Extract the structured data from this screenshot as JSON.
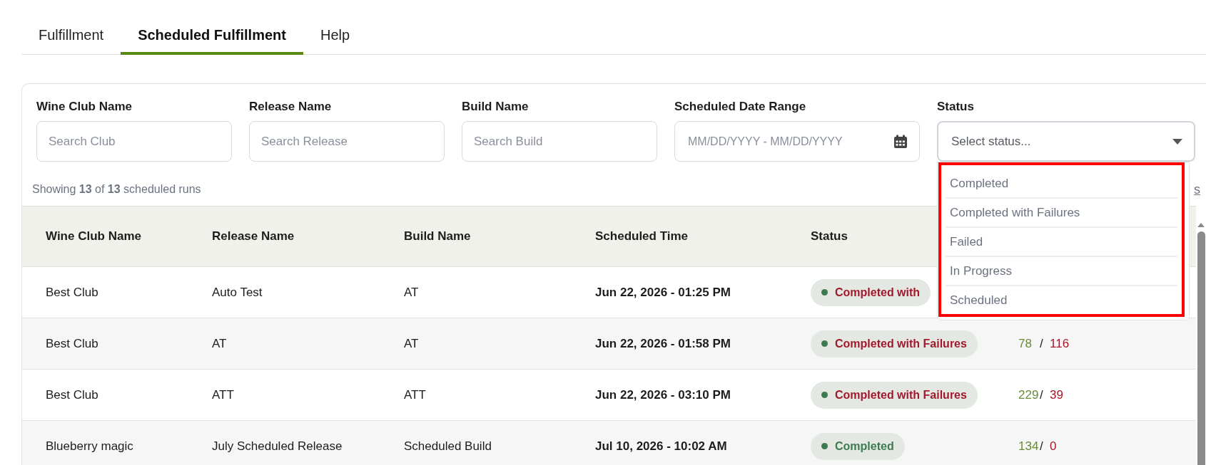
{
  "tabs": [
    {
      "label": "Fulfillment",
      "selected": false
    },
    {
      "label": "Scheduled Fulfillment",
      "selected": true
    },
    {
      "label": "Help",
      "selected": false
    }
  ],
  "filters": [
    {
      "kind": "text",
      "label": "Wine Club Name",
      "placeholder": "Search Club"
    },
    {
      "kind": "text",
      "label": "Release Name",
      "placeholder": "Search Release"
    },
    {
      "kind": "text",
      "label": "Build Name",
      "placeholder": "Search Build"
    },
    {
      "kind": "date",
      "label": "Scheduled Date Range",
      "placeholder": "MM/DD/YYYY - MM/DD/YYYY"
    },
    {
      "kind": "select",
      "label": "Status",
      "placeholder": "Select status...",
      "expanded": true,
      "options": [
        "Completed",
        "Completed with Failures",
        "Failed",
        "In Progress",
        "Scheduled"
      ]
    }
  ],
  "summary": "Showing **13** of **13** scheduled runs",
  "summary_link": "s",
  "table": {
    "columns": [
      "Wine Club Name",
      "Release Name",
      "Build Name",
      "Scheduled Time",
      "Status"
    ],
    "rows": [
      {
        "club": "Best Club",
        "release": "Auto Test",
        "build": "AT",
        "time": "Jun 22, 2026 - 01:25 PM",
        "status": {
          "label": "Completed with",
          "kind": "failures"
        }
      },
      {
        "club": "Best Club",
        "release": "AT",
        "build": "AT",
        "time": "Jun 22, 2026 - 01:58 PM",
        "status": {
          "label": "Completed with Failures",
          "kind": "failures"
        },
        "passed": "78",
        "separator": "/",
        "failed": "116"
      },
      {
        "club": "Best Club",
        "release": "ATT",
        "build": "ATT",
        "time": "Jun 22, 2026 - 03:10 PM",
        "status": {
          "label": "Completed with Failures",
          "kind": "failures"
        },
        "passed": "229",
        "separator": "/",
        "failed": "39"
      },
      {
        "club": "Blueberry magic",
        "release": "July Scheduled Release",
        "build": "Scheduled Build",
        "time": "Jul 10, 2026 - 10:02 AM",
        "status": {
          "label": "Completed",
          "kind": "completed"
        },
        "passed": "134",
        "separator": "/",
        "failed": "0"
      }
    ]
  }
}
